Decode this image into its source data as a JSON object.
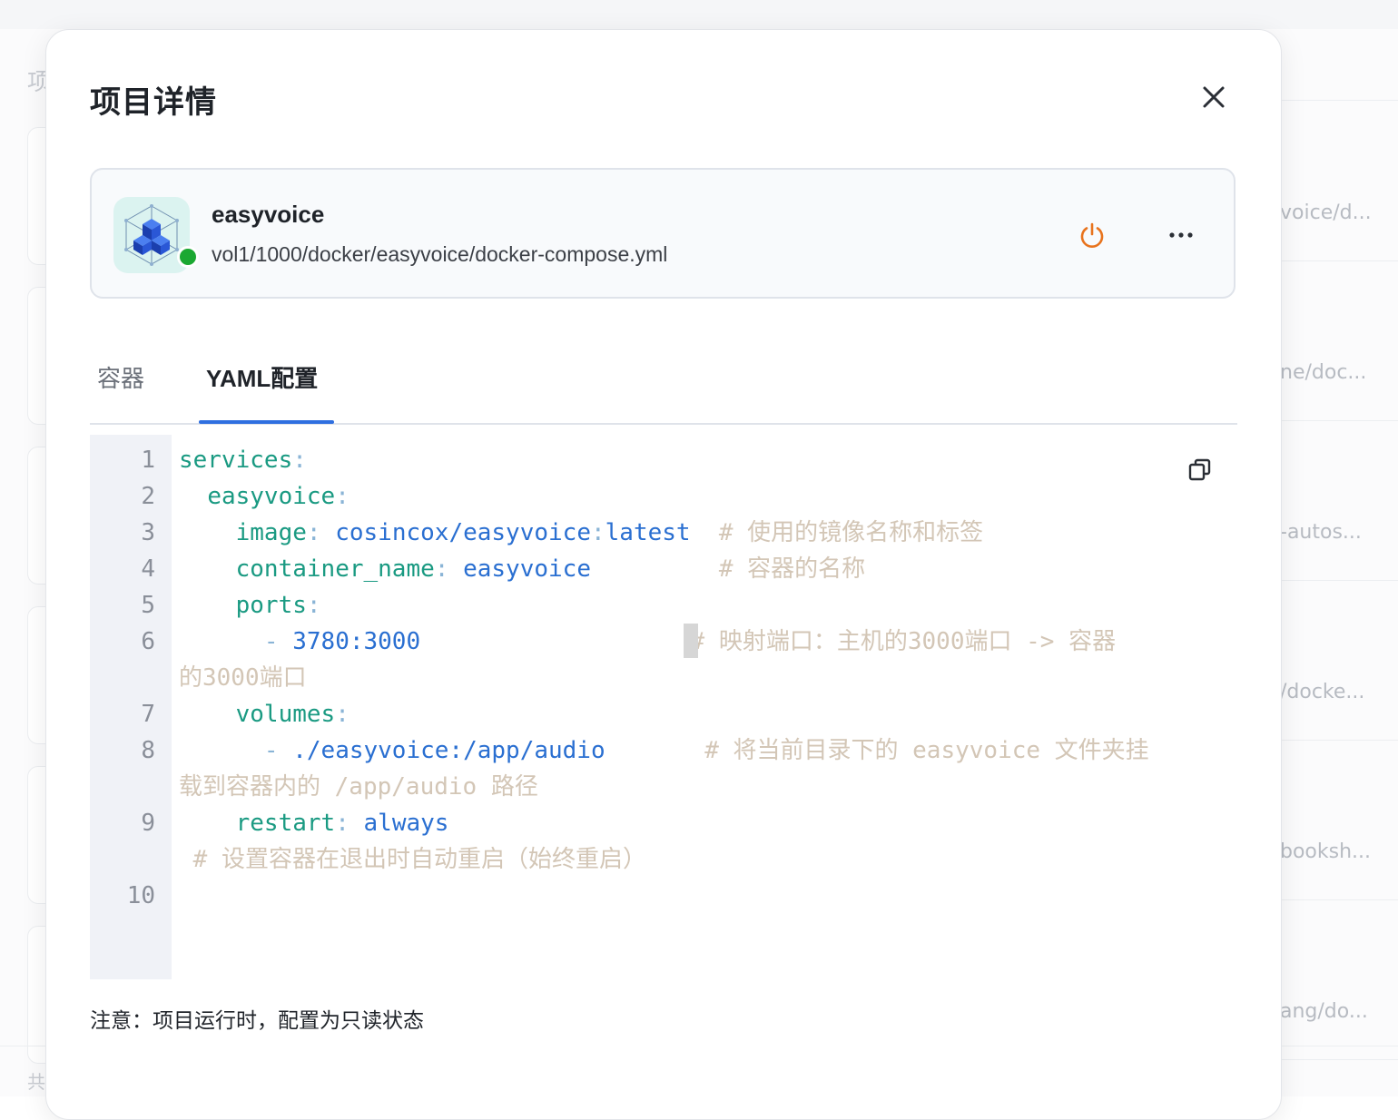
{
  "background": {
    "section_title": "项",
    "footer_text": "共",
    "right_rows": [
      "voice/d...",
      "ne/doc...",
      "-autos...",
      "/docke...",
      "booksh...",
      "ang/do..."
    ]
  },
  "modal": {
    "title": "项目详情",
    "project": {
      "name": "easyvoice",
      "path": "vol1/1000/docker/easyvoice/docker-compose.yml",
      "status": "running",
      "status_color": "#1ba832",
      "power_color": "#e8731d"
    },
    "tabs": [
      {
        "label": "容器",
        "active": false
      },
      {
        "label": "YAML配置",
        "active": true
      }
    ],
    "editor": {
      "line_numbers": [
        "1",
        "2",
        "3",
        "4",
        "5",
        "6",
        "7",
        "8",
        "9",
        "10"
      ],
      "lines": {
        "l1_key": "services",
        "l2_key": "easyvoice",
        "l3_key": "image",
        "l3_value": "cosincox/easyvoice",
        "l3_value_tag": "latest",
        "l3_comment": "# 使用的镜像名称和标签",
        "l4_key": "container_name",
        "l4_value": "easyvoice",
        "l4_comment": "# 容器的名称",
        "l5_key": "ports",
        "l6_dash": "-",
        "l6_value": "3780:3000",
        "l6_comment": "# 映射端口：主机的3000端口 -> 容器",
        "l6_comment_wrap": "的3000端口",
        "l7_key": "volumes",
        "l8_dash": "-",
        "l8_value": "./easyvoice:/app/audio",
        "l8_comment": "# 将当前目录下的 easyvoice 文件夹挂",
        "l8_comment_wrap": "载到容器内的 /app/audio 路径",
        "l9_key": "restart",
        "l9_value": "always",
        "l9_comment_wrap": "# 设置容器在退出时自动重启（始终重启）"
      }
    },
    "note": "注意：项目运行时，配置为只读状态"
  }
}
